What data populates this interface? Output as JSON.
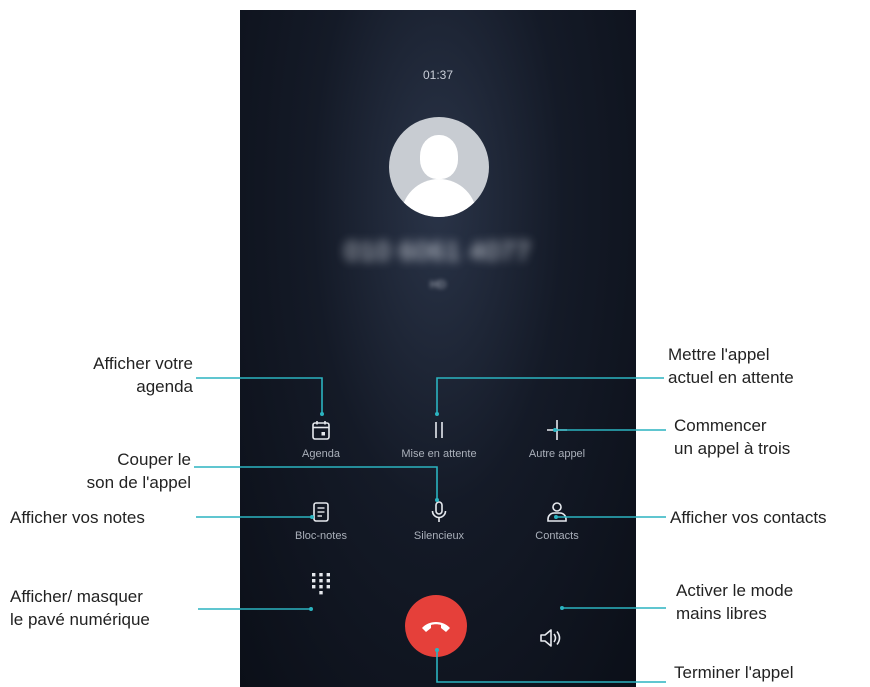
{
  "call": {
    "duration": "01:37",
    "number": "010 6061 4077",
    "status": "HD"
  },
  "buttons": {
    "agenda": "Agenda",
    "hold": "Mise en attente",
    "add_call": "Autre appel",
    "notes": "Bloc-notes",
    "mute": "Silencieux",
    "contacts": "Contacts"
  },
  "annotations": {
    "agenda_1": "Afficher votre",
    "agenda_2": "agenda",
    "hold_1": "Mettre l'appel",
    "hold_2": "actuel en attente",
    "add_1": "Commencer",
    "add_2": "un appel à trois",
    "mute_1": "Couper le",
    "mute_2": "son de l'appel",
    "notes": "Afficher vos notes",
    "contacts": "Afficher vos contacts",
    "keypad_1": "Afficher/ masquer",
    "keypad_2": "le pavé numérique",
    "speaker_1": "Activer le mode",
    "speaker_2": "mains libres",
    "end": "Terminer l'appel"
  },
  "colors": {
    "accent": "#2bb3c0",
    "end_call": "#e5403a"
  }
}
